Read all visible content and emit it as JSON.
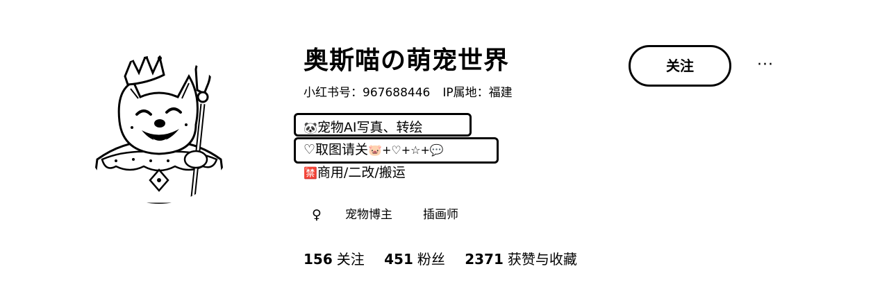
{
  "profile": {
    "name": "奥斯喵の萌宠世界",
    "id_label": "小红书号：",
    "id_value": "967688446",
    "ip_label": "IP属地：",
    "ip_value": "福建"
  },
  "actions": {
    "follow_label": "关注",
    "more_label": "···"
  },
  "bio": {
    "line1_icon": "🐼",
    "line1_text": "宠物AI写真、转绘",
    "line2_icon": "♡",
    "line2_text": "取图请关",
    "line2_suffix": "🐷+♡+☆+💬",
    "line3_icon": "🈲",
    "line3_text": "商用/二改/搬运"
  },
  "tags": {
    "gender_icon": "♀",
    "items": [
      "宠物博主",
      "插画师"
    ]
  },
  "stats": [
    {
      "num": "156",
      "label": "关注"
    },
    {
      "num": "451",
      "label": "粉丝"
    },
    {
      "num": "2371",
      "label": "获赞与收藏"
    }
  ],
  "icons": {
    "avatar": "cartoon-dog-king-avatar",
    "gender": "female-icon"
  }
}
